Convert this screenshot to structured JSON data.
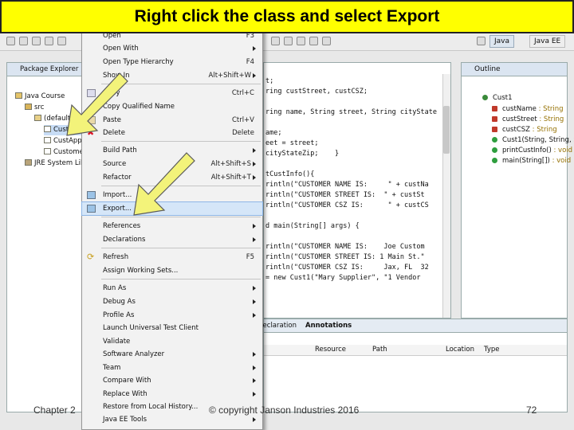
{
  "slide": {
    "title": "Right click the class and select Export",
    "footer_left": "Chapter 2",
    "footer_center": "© copyright Janson Industries 2016",
    "page_number": "72",
    "title_bg_color": "#ffff00",
    "arrow_color": "#f3f37a"
  },
  "toolbar": {
    "perspective_java": "Java",
    "perspective_other": "Java EE"
  },
  "package_explorer": {
    "tab_label": "Package Explorer",
    "items": [
      {
        "label": "Java Course"
      },
      {
        "label": "src"
      },
      {
        "label": "(default package)"
      },
      {
        "label": "Cust1.java"
      },
      {
        "label": "CustApp.java"
      },
      {
        "label": "Customer.java"
      },
      {
        "label": "JRE System Library"
      }
    ]
  },
  "editor": {
    "lines": [
      "t;",
      "ring custStreet, custCSZ;",
      "",
      "ring name, String street, String cityState",
      "",
      "ame;",
      "eet = street;",
      "cityStateZip;    }",
      "",
      "tCustInfo(){",
      "rintln(\"CUSTOMER NAME IS:     \" + custNa",
      "rintln(\"CUSTOMER STREET IS:  \" + custSt",
      "rintln(\"CUSTOMER CSZ IS:      \" + custCS",
      "",
      "d main(String[] args) {",
      "",
      "rintln(\"CUSTOMER NAME IS:    Joe Custom",
      "rintln(\"CUSTOMER STREET IS: 1 Main St.\"",
      "rintln(\"CUSTOMER CSZ IS:     Jax, FL  32",
      "= new Cust1(\"Mary Supplier\", \"1 Vendor"
    ]
  },
  "outline": {
    "tab_label": "Outline",
    "class_name": "Cust1",
    "members": [
      {
        "name": "custName",
        "type": " : String"
      },
      {
        "name": "custStreet",
        "type": " : String"
      },
      {
        "name": "custCSZ",
        "type": " : String"
      },
      {
        "name": "Cust1(String, String, String)",
        "type": ""
      },
      {
        "name": "printCustInfo()",
        "type": " : void"
      },
      {
        "name": "main(String[])",
        "type": " : void"
      }
    ]
  },
  "bottom_panel": {
    "tabs": [
      "Declaration",
      "Annotations"
    ],
    "columns": [
      "Resource",
      "Path",
      "Location",
      "Type"
    ]
  },
  "context_menu": {
    "items": [
      {
        "label": "Open",
        "shortcut": "F3",
        "submenu": false
      },
      {
        "label": "Open With",
        "shortcut": "",
        "submenu": true
      },
      {
        "label": "Open Type Hierarchy",
        "shortcut": "F4",
        "submenu": false
      },
      {
        "label": "Show In",
        "shortcut": "Alt+Shift+W",
        "submenu": true
      },
      {
        "label": "Copy",
        "shortcut": "Ctrl+C",
        "submenu": false
      },
      {
        "label": "Copy Qualified Name",
        "shortcut": "",
        "submenu": false
      },
      {
        "label": "Paste",
        "shortcut": "Ctrl+V",
        "submenu": false
      },
      {
        "label": "Delete",
        "shortcut": "Delete",
        "submenu": false
      },
      {
        "label": "Build Path",
        "shortcut": "",
        "submenu": true
      },
      {
        "label": "Source",
        "shortcut": "Alt+Shift+S",
        "submenu": true
      },
      {
        "label": "Refactor",
        "shortcut": "Alt+Shift+T",
        "submenu": true
      },
      {
        "label": "Import...",
        "shortcut": "",
        "submenu": false
      },
      {
        "label": "Export...",
        "shortcut": "",
        "submenu": false
      },
      {
        "label": "References",
        "shortcut": "",
        "submenu": true
      },
      {
        "label": "Declarations",
        "shortcut": "",
        "submenu": true
      },
      {
        "label": "Refresh",
        "shortcut": "F5",
        "submenu": false
      },
      {
        "label": "Assign Working Sets...",
        "shortcut": "",
        "submenu": false
      },
      {
        "label": "Run As",
        "shortcut": "",
        "submenu": true
      },
      {
        "label": "Debug As",
        "shortcut": "",
        "submenu": true
      },
      {
        "label": "Profile As",
        "shortcut": "",
        "submenu": true
      },
      {
        "label": "Launch Universal Test Client",
        "shortcut": "",
        "submenu": false
      },
      {
        "label": "Validate",
        "shortcut": "",
        "submenu": false
      },
      {
        "label": "Software Analyzer",
        "shortcut": "",
        "submenu": true
      },
      {
        "label": "Team",
        "shortcut": "",
        "submenu": true
      },
      {
        "label": "Compare With",
        "shortcut": "",
        "submenu": true
      },
      {
        "label": "Replace With",
        "shortcut": "",
        "submenu": true
      },
      {
        "label": "Restore from Local History...",
        "shortcut": "",
        "submenu": false
      },
      {
        "label": "Java EE Tools",
        "shortcut": "",
        "submenu": true
      }
    ]
  }
}
